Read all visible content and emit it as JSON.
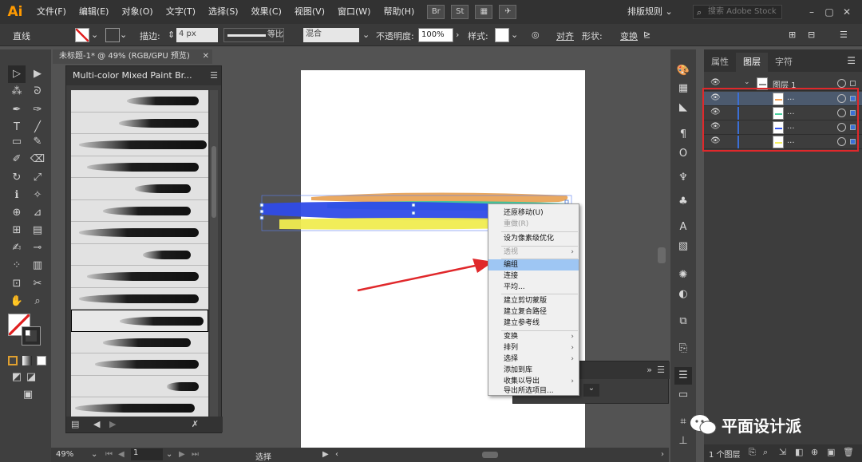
{
  "menubar": {
    "logo": "Ai",
    "items": [
      "文件(F)",
      "编辑(E)",
      "对象(O)",
      "文字(T)",
      "选择(S)",
      "效果(C)",
      "视图(V)",
      "窗口(W)",
      "帮助(H)"
    ],
    "bridge_label": "Br",
    "stock_label": "St",
    "arrange_label": "排版规则",
    "search_placeholder": "搜索 Adobe Stock",
    "window_controls": [
      "minimize-icon",
      "restore-icon",
      "close-icon"
    ]
  },
  "controlbar": {
    "selection_name": "直线",
    "stroke_label": "描边:",
    "stroke_value": "4 px",
    "profile_label": "等比",
    "blend_mode": "混合",
    "opacity_label": "不透明度:",
    "opacity_value": "100%",
    "style_label": "样式:",
    "align_label": "对齐",
    "shape_label": "形状:",
    "transform_label": "变换"
  },
  "document": {
    "tab_title": "未标题-1* @ 49% (RGB/GPU 预览)",
    "zoom": "49%",
    "artboard_number": "1",
    "status_text": "选择"
  },
  "brush_panel": {
    "title": "Multi-color Mixed Paint Br...",
    "selected_index": 10,
    "row_count": 15
  },
  "context_menu": {
    "items": [
      {
        "label": "还原移动(U)",
        "disabled": false
      },
      {
        "label": "重做(R)",
        "disabled": true
      },
      {
        "label": "设为像素级优化",
        "disabled": false
      },
      {
        "label": "透视",
        "disabled": true,
        "submenu": true
      },
      {
        "label": "编组",
        "disabled": false,
        "highlighted": true
      },
      {
        "label": "连接",
        "disabled": false
      },
      {
        "label": "平均...",
        "disabled": false
      },
      {
        "label": "建立剪切蒙版",
        "disabled": false
      },
      {
        "label": "建立复合路径",
        "disabled": false
      },
      {
        "label": "建立参考线",
        "disabled": false
      },
      {
        "label": "变换",
        "disabled": false,
        "submenu": true
      },
      {
        "label": "排列",
        "disabled": false,
        "submenu": true
      },
      {
        "label": "选择",
        "disabled": false,
        "submenu": true
      },
      {
        "label": "添加到库",
        "disabled": false
      },
      {
        "label": "收集以导出",
        "disabled": false,
        "submenu": true
      },
      {
        "label": "导出所选项目...",
        "disabled": false
      }
    ]
  },
  "layers_panel": {
    "tabs": [
      "属性",
      "图层",
      "字符"
    ],
    "active_tab": "图层",
    "layer_name": "图层 1",
    "sublayers": [
      {
        "name": "...",
        "color": "#f4a259"
      },
      {
        "name": "...",
        "color": "#4bd1a0"
      },
      {
        "name": "...",
        "color": "#3355ee"
      },
      {
        "name": "...",
        "color": "#f5f060"
      }
    ],
    "footer_count": "1 个图层"
  },
  "watermark": {
    "text": "平面设计派"
  },
  "colors": {
    "annotation_red": "#e0282b",
    "selection_blue": "#3b6fd6",
    "menu_highlight": "#9ec6f3"
  }
}
